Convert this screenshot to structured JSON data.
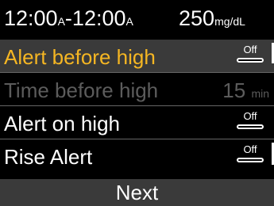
{
  "header": {
    "start_time": "12:00",
    "start_ampm": "A",
    "separator": "-",
    "end_time": "12:00",
    "end_ampm": "A",
    "value": "250",
    "unit": "mg/dL"
  },
  "rows": [
    {
      "label": "Alert before high",
      "state": "Off",
      "selected": true
    },
    {
      "label": "Time before high",
      "value": "15",
      "unit": "min",
      "disabled": true
    },
    {
      "label": "Alert on high",
      "state": "Off"
    },
    {
      "label": "Rise Alert",
      "state": "Off"
    }
  ],
  "footer": {
    "next_label": "Next"
  }
}
